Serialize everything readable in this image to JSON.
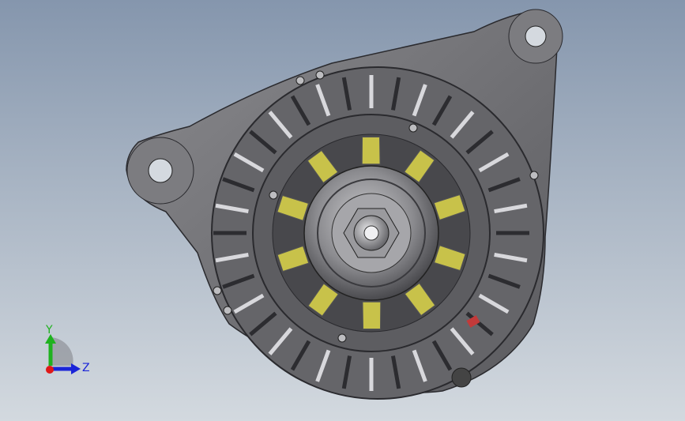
{
  "viewport": {
    "background_top": "#8596ad",
    "background_bottom": "#d3d9df"
  },
  "model": {
    "housing_color": "#6e6e72",
    "fan_blade_color": "#c8c24a",
    "pulley_color": "#8d8d90",
    "accent_red": "#c23a3a"
  },
  "triad": {
    "y_label": "Y",
    "z_label": "Z",
    "y_color": "#1fb21f",
    "z_color": "#1a24d8",
    "x_color": "#e01818"
  }
}
